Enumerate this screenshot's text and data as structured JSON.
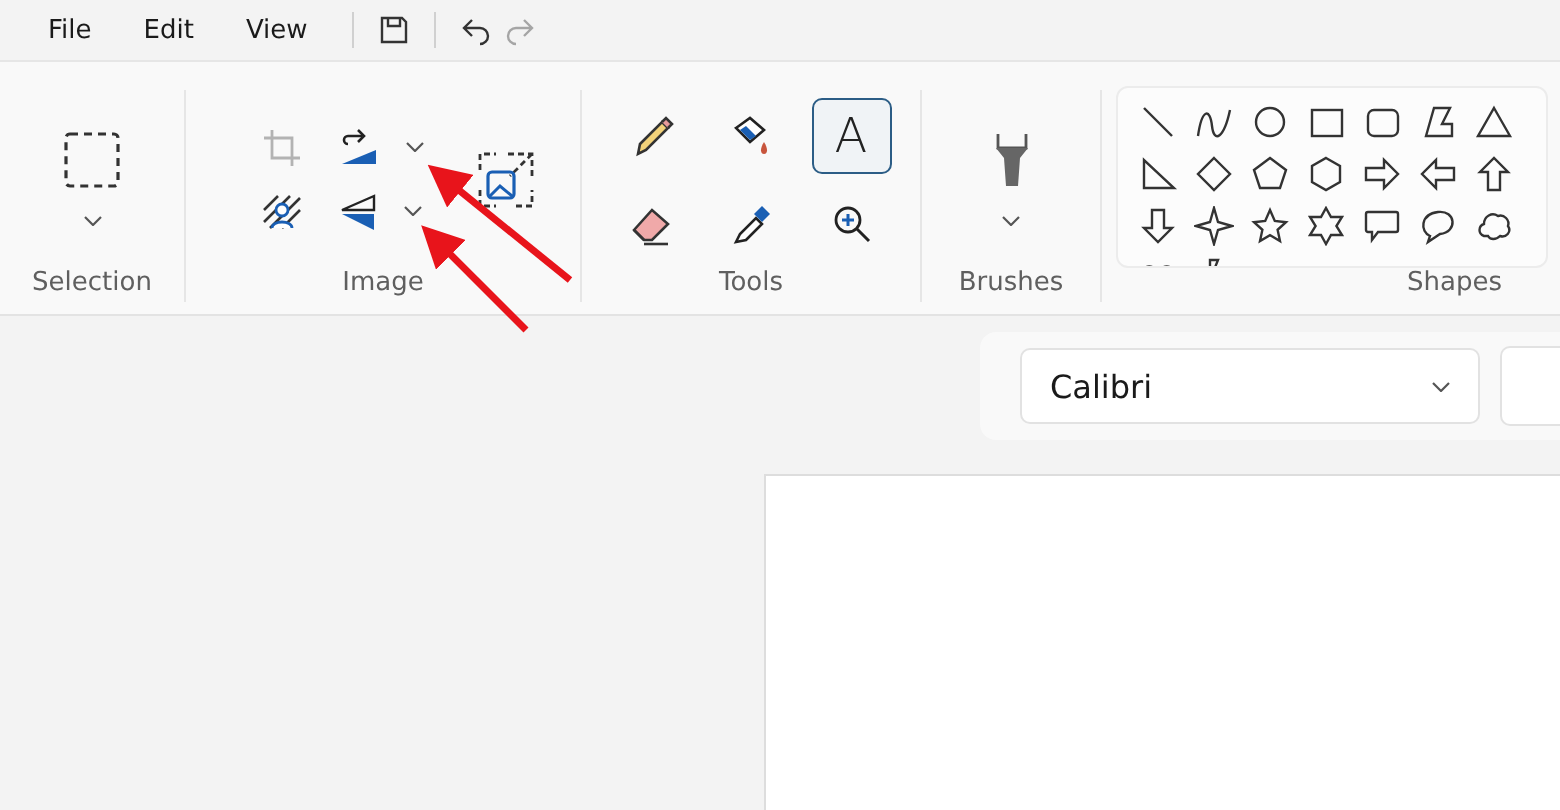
{
  "menu": [
    {
      "label": "File"
    },
    {
      "label": "Edit"
    },
    {
      "label": "View"
    }
  ],
  "selection": {
    "label": "Selection"
  },
  "image": {
    "label": "Image",
    "items": [
      {
        "kind": "crop",
        "disabled": true
      },
      {
        "kind": "rotate",
        "disabled": false
      },
      {
        "kind": "remove-background",
        "disabled": false
      },
      {
        "kind": "flip",
        "disabled": false
      }
    ]
  },
  "tools": {
    "label": "Tools",
    "items": [
      {
        "kind": "pencil",
        "selected": false
      },
      {
        "kind": "fill",
        "selected": false
      },
      {
        "kind": "text",
        "symbol": "A",
        "selected": true
      },
      {
        "kind": "eraser",
        "selected": false
      },
      {
        "kind": "picker",
        "selected": false
      },
      {
        "kind": "magnifier",
        "selected": false
      }
    ]
  },
  "brushes": {
    "label": "Brushes"
  },
  "shapes": {
    "label": "Shapes"
  },
  "text_toolbar": {
    "font": {
      "value": "Calibri"
    }
  },
  "annotations": [
    {
      "kind": "arrow"
    },
    {
      "kind": "arrow"
    }
  ]
}
